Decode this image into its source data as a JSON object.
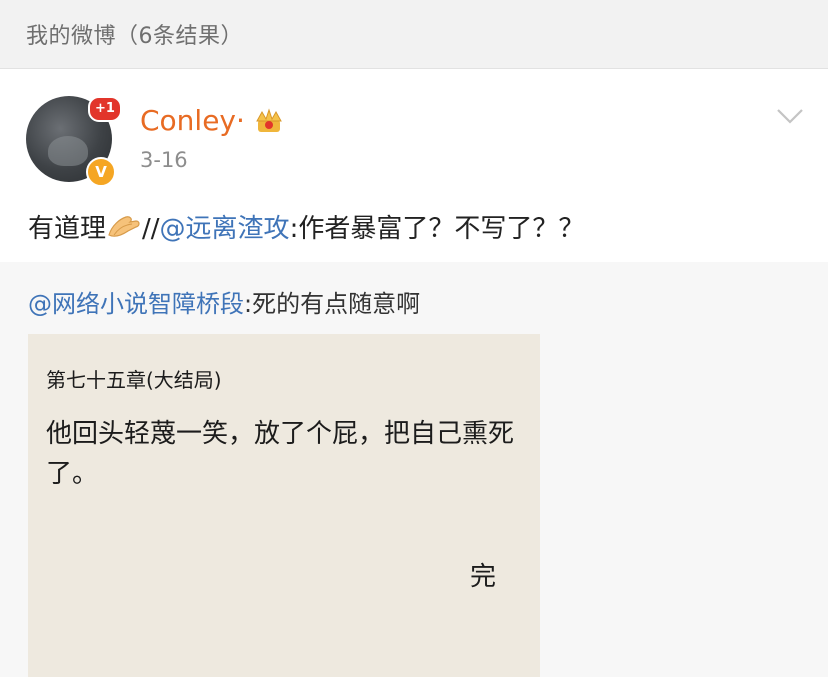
{
  "header": {
    "title": "我的微博（6条结果）"
  },
  "post": {
    "badge_count": "+1",
    "verified_mark": "V",
    "username": "Conley·",
    "date": "3-16",
    "text_before": "有道理",
    "text_sep": "//",
    "mention": "@远离渣攻",
    "text_after": ":作者暴富了？不写了？？",
    "icons": [
      "avatar",
      "notification-badge",
      "verified-badge",
      "crown-icon",
      "chevron-down-icon",
      "clap-hands-emoji"
    ]
  },
  "repost": {
    "mention": "@网络小说智障桥段",
    "text": ":死的有点随意啊",
    "image": {
      "chapter": "第七十五章(大结局)",
      "body": "他回头轻蔑一笑，放了个屁，把自己熏死了。",
      "end": "完"
    }
  },
  "colors": {
    "username": "#e86b23",
    "link": "#3f74b8",
    "badge": "#e2352b",
    "verified": "#f5a623",
    "card_bg": "#eee9df"
  }
}
